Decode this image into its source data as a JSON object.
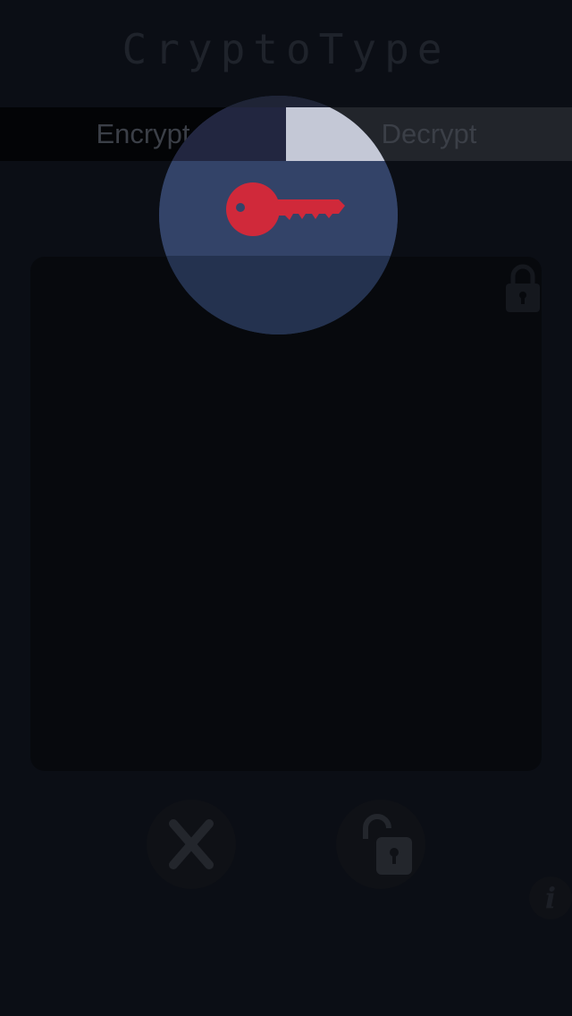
{
  "app": {
    "title": "CryptoType"
  },
  "mode_tabs": {
    "encrypt_label": "Encrypt",
    "decrypt_label": "Decrypt",
    "selected": "Encrypt"
  },
  "icons": {
    "editor_lock": "lock-icon",
    "clear": "close-icon",
    "encrypt": "unlock-icon",
    "info": "info-icon",
    "magnifier": "key-icon"
  },
  "info": {
    "glyph": "i"
  },
  "colors": {
    "background": "#0b0e15",
    "key_accent": "#d0293a",
    "magnifier_highlight": "#334368"
  }
}
